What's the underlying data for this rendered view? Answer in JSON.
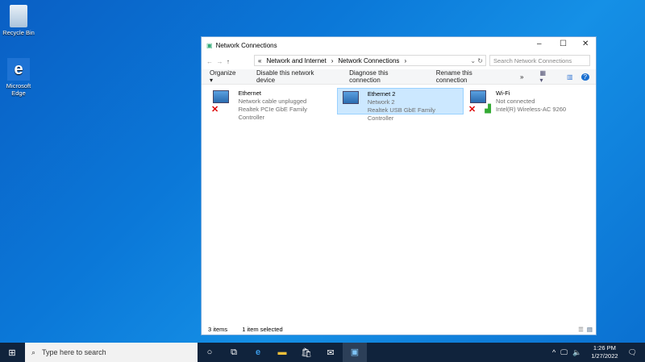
{
  "desktop": {
    "recycle_bin": "Recycle Bin",
    "edge": "Microsoft Edge"
  },
  "window": {
    "title": "Network Connections",
    "breadcrumb": [
      "Network and Internet",
      "Network Connections"
    ],
    "search_placeholder": "Search Network Connections",
    "commands": [
      "Organize ▾",
      "Disable this network device",
      "Diagnose this connection",
      "Rename this connection",
      "»"
    ],
    "items": [
      {
        "name": "Ethernet",
        "status": "Network cable unplugged",
        "device": "Realtek PCIe GbE Family Controller"
      },
      {
        "name": "Ethernet 2",
        "status": "Network 2",
        "device": "Realtek USB GbE Family Controller"
      },
      {
        "name": "Wi-Fi",
        "status": "Not connected",
        "device": "Intel(R) Wireless-AC 9260"
      }
    ],
    "status_count": "3 items",
    "status_selected": "1 item selected"
  },
  "taskbar": {
    "search": "Type here to search",
    "time": "1:26 PM",
    "date": "1/27/2022"
  }
}
